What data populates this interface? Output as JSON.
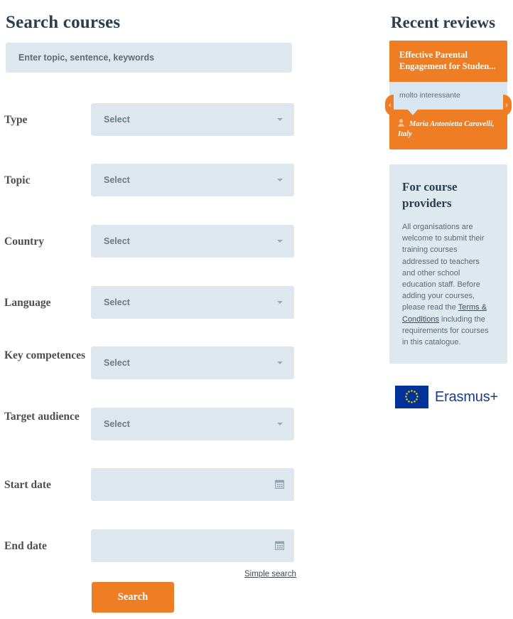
{
  "search_panel": {
    "title": "Search courses",
    "keyword_input": {
      "value": "",
      "placeholder": "Enter topic, sentence, keywords",
      "name": "keyword-search-input"
    },
    "fields": [
      {
        "label": "Type",
        "value": "Select",
        "control": "select",
        "name": "type"
      },
      {
        "label": "Topic",
        "value": "Select",
        "control": "select",
        "name": "topic"
      },
      {
        "label": "Country",
        "value": "Select",
        "control": "select",
        "name": "country"
      },
      {
        "label": "Language",
        "value": "Select",
        "control": "select",
        "name": "language"
      },
      {
        "label": "Key competences",
        "value": "Select",
        "control": "select",
        "name": "key-competences"
      },
      {
        "label": "Target audience",
        "value": "Select",
        "control": "select",
        "name": "target-audience"
      },
      {
        "label": "Start date",
        "value": "",
        "control": "date",
        "name": "start-date"
      },
      {
        "label": "End date",
        "value": "",
        "control": "date",
        "name": "end-date"
      }
    ],
    "simple_search_link": "Simple search",
    "search_button": "Search"
  },
  "sidebar": {
    "reviews_title": "Recent reviews",
    "review": {
      "course_title": "Effective Parental Engagement for Studen...",
      "quote": "molto interessante",
      "author": "Maria Antonietta Caravelli, Italy",
      "prev_label": "‹",
      "next_label": "›"
    },
    "providers": {
      "title": "For course providers",
      "text_before_link": "All organisations are welcome to submit their training courses addressed to teachers and other school education staff. Before adding your courses, please read the ",
      "link_text": "Terms & Conditions",
      "text_after_link": " including the requirements for courses in this catalogue."
    },
    "erasmus_logo_text": "Erasmus+"
  },
  "colors": {
    "accent_orange": "#ee7d23",
    "field_bg": "#dde7ed",
    "heading_navy": "#2b3d50",
    "quote_bg": "#d7e6f0",
    "providers_bg": "#dde8ef",
    "eu_blue": "#003399",
    "eu_star_yellow": "#ffcc00"
  }
}
